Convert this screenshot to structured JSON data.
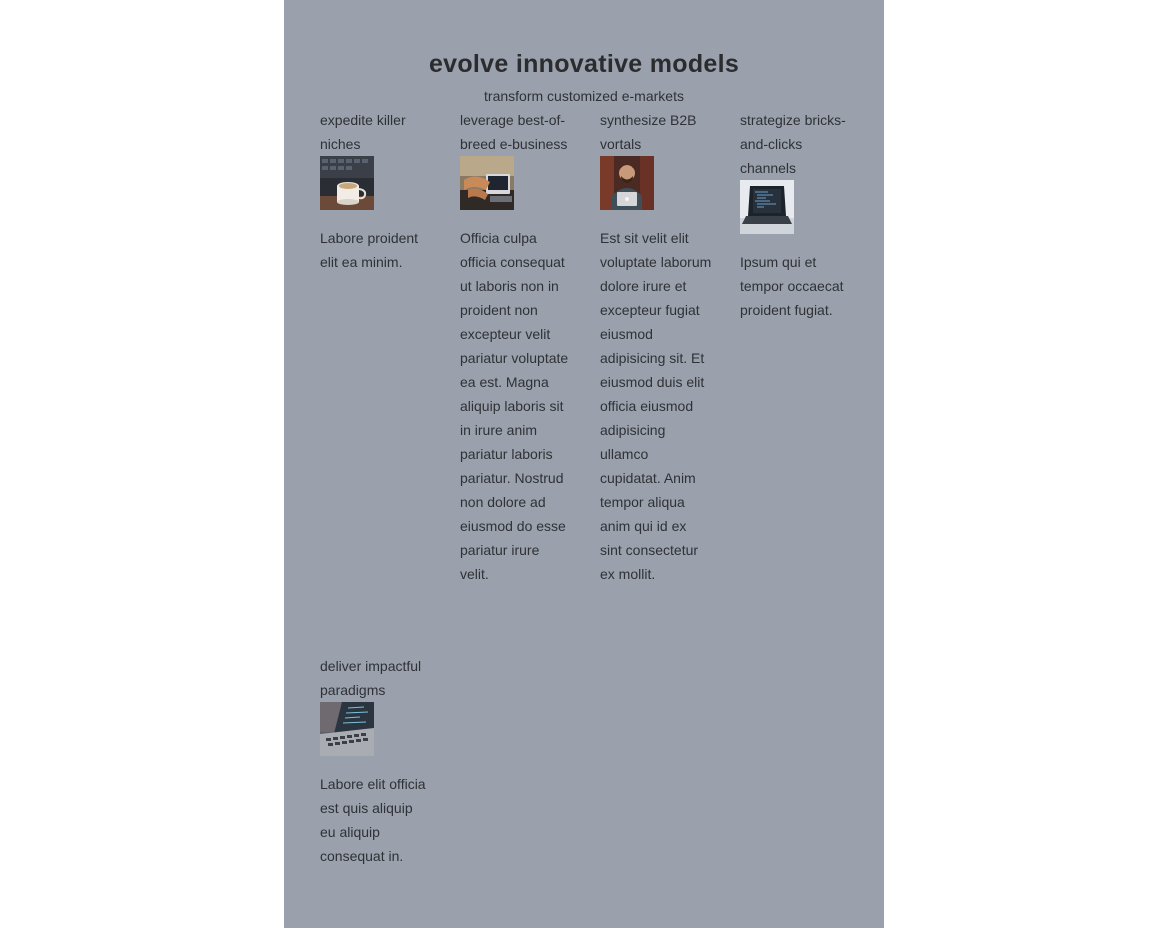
{
  "header": {
    "title": "evolve innovative models",
    "subtitle": "transform customized e-markets"
  },
  "cards": [
    {
      "heading": "expedite killer niches",
      "image": "coffee-mug-keyboard-photo",
      "body": "Labore proident elit ea minim."
    },
    {
      "heading": "leverage best-of-breed e-business",
      "image": "hands-typing-laptop-photo",
      "body": "Officia culpa officia consequat ut laboris non in proident non excepteur velit pariatur voluptate ea est. Magna aliquip laboris sit in irure anim pariatur laboris pariatur. Nostrud non dolore ad eiusmod do esse pariatur irure velit."
    },
    {
      "heading": "synthesize B2B vortals",
      "image": "man-smiling-laptop-photo",
      "body": "Est sit velit elit voluptate laborum dolore irure et excepteur fugiat eiusmod adipisicing sit. Et eiusmod duis elit officia eiusmod adipisicing ullamco cupidatat. Anim tempor aliqua anim qui id ex sint consectetur ex mollit."
    },
    {
      "heading": "strategize bricks-and-clicks channels",
      "image": "laptop-code-screen-photo",
      "body": "Ipsum qui et tempor occaecat proident fugiat."
    },
    {
      "heading": "deliver impactful paradigms",
      "image": "laptop-keyboard-closeup-photo",
      "body": "Labore elit officia est quis aliquip eu aliquip consequat in."
    }
  ]
}
